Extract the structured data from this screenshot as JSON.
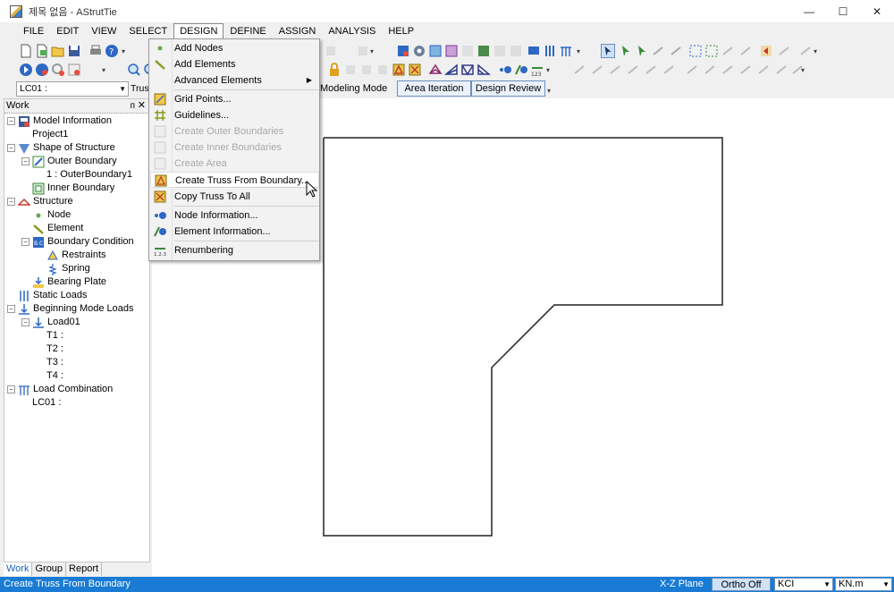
{
  "window": {
    "title": "제목 없음 - AStrutTie",
    "minimize": "—",
    "maximize": "☐",
    "close": "✕"
  },
  "menubar": [
    "FILE",
    "EDIT",
    "VIEW",
    "SELECT",
    "DESIGN",
    "DEFINE",
    "ASSIGN",
    "ANALYSIS",
    "HELP"
  ],
  "toolbar": {
    "load_case": "LC01 :",
    "truss_combo": "Trus"
  },
  "modes": {
    "label": "Modeling Mode",
    "tabs": [
      "Area Iteration",
      "Design Review"
    ]
  },
  "panel": {
    "title": "Work",
    "pin": "ᴨ",
    "close": "✕",
    "tree": [
      {
        "label": "Model Information",
        "indent": 0,
        "toggle": "−",
        "icon": "model-info-icon"
      },
      {
        "label": "Project1",
        "indent": 1,
        "toggle": "",
        "icon": ""
      },
      {
        "label": "Shape of Structure",
        "indent": 0,
        "toggle": "−",
        "icon": "shape-icon"
      },
      {
        "label": "Outer Boundary",
        "indent": 1,
        "toggle": "−",
        "icon": "outer-boundary-icon"
      },
      {
        "label": "1 : OuterBoundary1",
        "indent": 2,
        "toggle": "",
        "icon": ""
      },
      {
        "label": "Inner Boundary",
        "indent": 1,
        "toggle": "",
        "icon": "inner-boundary-icon"
      },
      {
        "label": "Structure",
        "indent": 0,
        "toggle": "−",
        "icon": "structure-icon"
      },
      {
        "label": "Node",
        "indent": 1,
        "toggle": "",
        "icon": "node-icon"
      },
      {
        "label": "Element",
        "indent": 1,
        "toggle": "",
        "icon": "element-icon"
      },
      {
        "label": "Boundary Condition",
        "indent": 1,
        "toggle": "−",
        "icon": "boundary-condition-icon"
      },
      {
        "label": "Restraints",
        "indent": 2,
        "toggle": "",
        "icon": "restraints-icon"
      },
      {
        "label": "Spring",
        "indent": 2,
        "toggle": "",
        "icon": "spring-icon"
      },
      {
        "label": "Bearing Plate",
        "indent": 1,
        "toggle": "",
        "icon": "bearing-plate-icon"
      },
      {
        "label": "Static Loads",
        "indent": 0,
        "toggle": "",
        "icon": "static-loads-icon"
      },
      {
        "label": "Beginning Mode Loads",
        "indent": 0,
        "toggle": "−",
        "icon": "mode-loads-icon"
      },
      {
        "label": "Load01",
        "indent": 1,
        "toggle": "−",
        "icon": "load-icon"
      },
      {
        "label": "T1 :",
        "indent": 2,
        "toggle": "",
        "icon": ""
      },
      {
        "label": "T2 :",
        "indent": 2,
        "toggle": "",
        "icon": ""
      },
      {
        "label": "T3 :",
        "indent": 2,
        "toggle": "",
        "icon": ""
      },
      {
        "label": "T4 :",
        "indent": 2,
        "toggle": "",
        "icon": ""
      },
      {
        "label": "Load Combination",
        "indent": 0,
        "toggle": "−",
        "icon": "load-combination-icon"
      },
      {
        "label": "LC01 :",
        "indent": 1,
        "toggle": "",
        "icon": ""
      }
    ],
    "tabs": [
      "Work",
      "Group",
      "Report"
    ]
  },
  "design_menu": {
    "items": [
      {
        "label": "Add Nodes",
        "disabled": false,
        "icon": "add-nodes-icon"
      },
      {
        "label": "Add Elements",
        "disabled": false,
        "icon": "add-elements-icon"
      },
      {
        "label": "Advanced Elements",
        "disabled": false,
        "icon": "",
        "submenu": true
      },
      {
        "label": "Grid Points...",
        "disabled": false,
        "icon": "grid-points-icon"
      },
      {
        "label": "Guidelines...",
        "disabled": false,
        "icon": "guidelines-icon"
      },
      {
        "label": "Create Outer Boundaries",
        "disabled": true,
        "icon": "create-outer-boundaries-icon"
      },
      {
        "label": "Create Inner Boundaries",
        "disabled": true,
        "icon": "create-inner-boundaries-icon"
      },
      {
        "label": "Create Area",
        "disabled": true,
        "icon": "create-area-icon"
      },
      {
        "label": "Create Truss From Boundary...",
        "disabled": false,
        "icon": "create-truss-icon",
        "hover": true
      },
      {
        "label": "Copy Truss To All",
        "disabled": false,
        "icon": "copy-truss-icon"
      },
      {
        "label": "Node Information...",
        "disabled": false,
        "icon": "node-information-icon"
      },
      {
        "label": "Element Information...",
        "disabled": false,
        "icon": "element-information-icon"
      },
      {
        "label": "Renumbering",
        "disabled": false,
        "icon": "renumbering-icon"
      }
    ]
  },
  "statusbar": {
    "message": "Create Truss From Boundary",
    "plane": "X-Z Plane",
    "ortho": "Ortho Off",
    "code": "KCI",
    "unit": "KN.m"
  }
}
